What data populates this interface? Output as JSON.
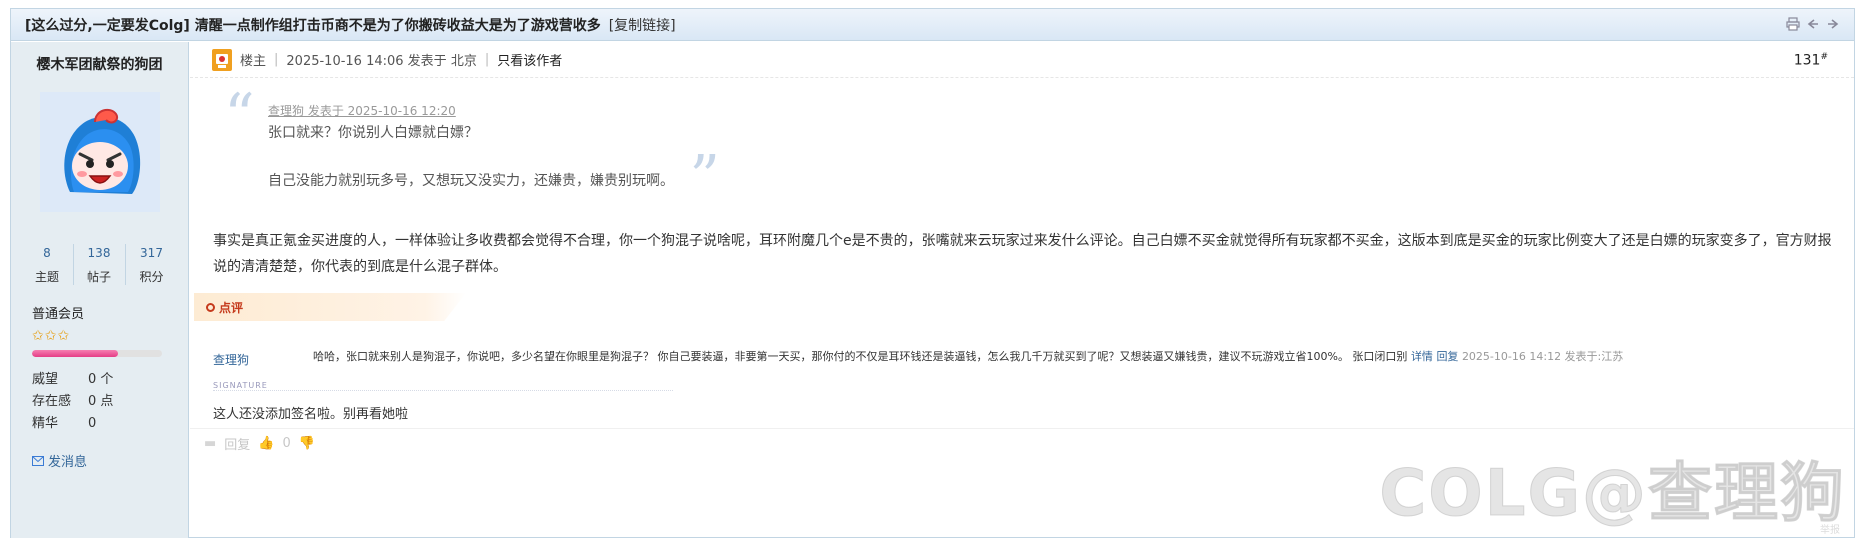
{
  "thread": {
    "title": "[这么过分,一定要发Colg] 清醒一点制作组打击币商不是为了你搬砖收益大是为了游戏营收多",
    "copy_link": "[复制链接]"
  },
  "author": {
    "name": "樱木军团献祭的狗团",
    "stats": [
      {
        "value": "8",
        "label": "主题"
      },
      {
        "value": "138",
        "label": "帖子"
      },
      {
        "value": "317",
        "label": "积分"
      }
    ],
    "group": "普通会员",
    "stars": "✩✩✩",
    "level_progress": 0.66,
    "attributes": [
      {
        "key": "威望",
        "value": "0 个"
      },
      {
        "key": "存在感",
        "value": "0 点"
      },
      {
        "key": "精华",
        "value": "0"
      }
    ],
    "send_message": "发消息"
  },
  "post": {
    "role": "楼主",
    "posted_at": "2025-10-16 14:06 发表于 北京",
    "only_author": "只看该作者",
    "floor": "131",
    "floor_suffix": "#",
    "quote": {
      "header": "查理狗 发表于 2025-10-16 12:20",
      "line1": "张口就来？你说别人白嫖就白嫖？",
      "line2": "自己没能力就别玩多号，又想玩又没实力，还嫌贵，嫌贵别玩啊。"
    },
    "body": "事实是真正氪金买进度的人，一样体验让多收费都会觉得不合理，你一个狗混子说啥呢，耳环附魔几个e是不贵的，张嘴就来云玩家过来发什么评论。自己白嫖不买金就觉得所有玩家都不买金，这版本到底是买金的玩家比例变大了还是白嫖的玩家变多了，官方财报说的清清楚楚，你代表的到底是什么混子群体。"
  },
  "comments": {
    "tag": "点评",
    "items": [
      {
        "user": "查理狗",
        "text": "哈哈，张口就来别人是狗混子，你说吧，多少名望在你眼里是狗混子？ 你自己要装逼，非要第一天买，那你付的不仅是耳环钱还是装逼钱，怎么我几千万就买到了呢？又想装逼又嫌钱贵，建议不玩游戏立省100%。 张口闭口别",
        "detail": "详情",
        "reply": "回复",
        "time": "2025-10-16 14:12 发表于:江苏"
      }
    ]
  },
  "signature": {
    "label": "SIGNATURE",
    "text": "这人还没添加签名啦。别再看她啦"
  },
  "actions": {
    "reply": "回复",
    "like_count": "0"
  },
  "watermark": "COLG@查理狗",
  "watermark_small": "举报"
}
